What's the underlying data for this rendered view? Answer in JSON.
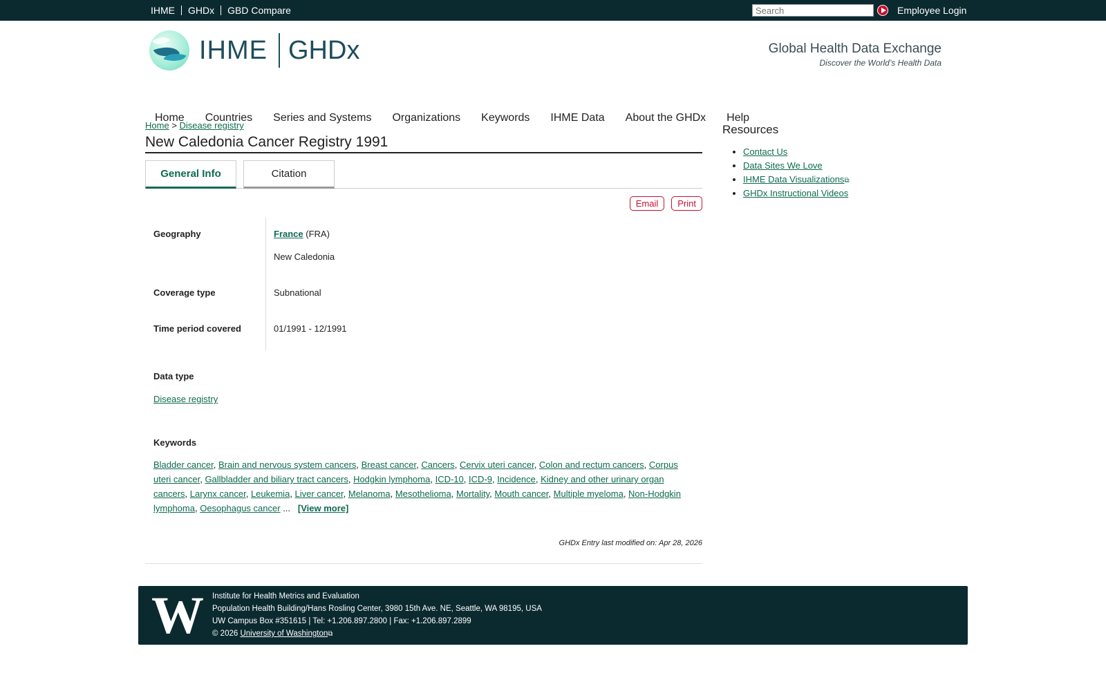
{
  "topbar": {
    "links": [
      "IHME",
      "GHDx",
      "GBD Compare"
    ],
    "search_placeholder": "Search",
    "employee_login": "Employee Login"
  },
  "header": {
    "brand_ihme": "IHME",
    "brand_ghdx": "GHDx",
    "tagline": "Global Health Data Exchange",
    "tagline_sub": "Discover the World’s Health Data"
  },
  "nav": [
    "Home",
    "Countries",
    "Series and Systems",
    "Organizations",
    "Keywords",
    "IHME Data",
    "About the GHDx",
    "Help"
  ],
  "breadcrumb": {
    "home": "Home",
    "sep": ">",
    "current": "Disease registry"
  },
  "page_title": "New Caledonia Cancer Registry 1991",
  "tabs": {
    "general": "General Info",
    "citation": "Citation"
  },
  "actions": {
    "email": "Email",
    "print": "Print"
  },
  "info": {
    "geography_label": "Geography",
    "country": "France",
    "country_code": "(FRA)",
    "subregion": "New Caledonia",
    "coverage_label": "Coverage type",
    "coverage_value": "Subnational",
    "time_label": "Time period covered",
    "time_value": "01/1991 - 12/1991"
  },
  "data_type": {
    "label": "Data type",
    "value": "Disease registry"
  },
  "keywords": {
    "label": "Keywords",
    "items": [
      "Bladder cancer",
      "Brain and nervous system cancers",
      "Breast cancer",
      "Cancers",
      "Cervix uteri cancer",
      "Colon and rectum cancers",
      "Corpus uteri cancer",
      "Gallbladder and biliary tract cancers",
      "Hodgkin lymphoma",
      "ICD-10",
      "ICD-9",
      "Incidence",
      "Kidney and other urinary organ cancers",
      "Larynx cancer",
      "Leukemia",
      "Liver cancer",
      "Melanoma",
      "Mesothelioma",
      "Mortality",
      "Mouth cancer",
      "Multiple myeloma",
      "Non-Hodgkin lymphoma",
      "Oesophagus cancer"
    ],
    "ellipsis": "...",
    "view_more": "[View more]"
  },
  "modified": "GHDx Entry last modified on: Apr 28, 2026",
  "sidebar": {
    "title": "Resources",
    "items": [
      "Contact Us",
      "Data Sites We Love",
      "IHME Data Visualizations",
      "GHDx Instructional Videos"
    ]
  },
  "footer": {
    "logo": "W",
    "line1": "Institute for Health Metrics and Evaluation",
    "line2": "Population Health Building/Hans Rosling Center, 3980 15th Ave. NE, Seattle, WA 98195, USA",
    "line3": "UW Campus Box #351615 | Tel: +1.206.897.2800 | Fax: +1.206.897.2899",
    "copyright": "© 2026",
    "uw_link": "University of Washington"
  }
}
